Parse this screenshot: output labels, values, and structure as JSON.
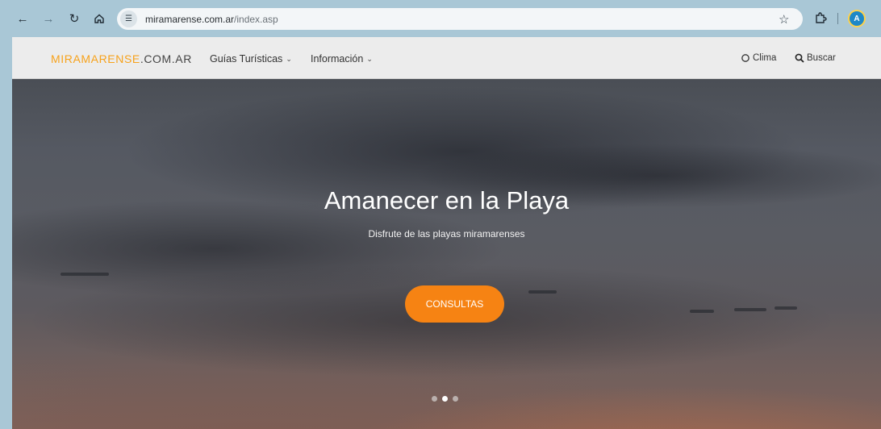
{
  "browser": {
    "url_domain": "miramarense.com.ar",
    "url_path": "/index.asp",
    "profile_initial": "A"
  },
  "site": {
    "logo_part1": "MIRAMARENSE",
    "logo_part2": ".COM.AR",
    "menu": [
      {
        "label": "Guías Turísticas",
        "icon": "chevron-down-icon"
      },
      {
        "label": "Información",
        "icon": "chevron-down-icon"
      }
    ],
    "right_menu": [
      {
        "label": "Clima",
        "icon": "weather-icon"
      },
      {
        "label": "Buscar",
        "icon": "search-icon"
      }
    ]
  },
  "hero": {
    "title": "Amanecer en la Playa",
    "subtitle": "Disfrute de las playas miramarenses",
    "cta_label": "CONSULTAS",
    "slides": 3,
    "active_slide": 2
  },
  "colors": {
    "brand_orange": "#f7a21b",
    "cta_orange": "#f68313"
  }
}
